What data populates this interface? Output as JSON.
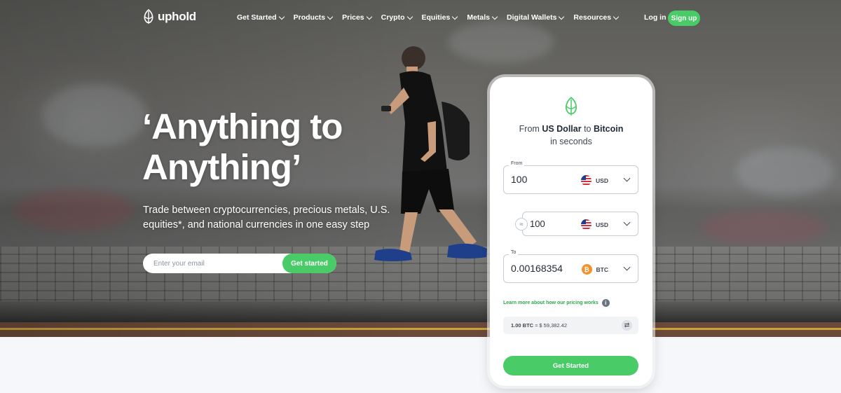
{
  "nav": {
    "logo_text": "uphold",
    "items": [
      {
        "label": "Get Started"
      },
      {
        "label": "Products"
      },
      {
        "label": "Prices"
      },
      {
        "label": "Crypto"
      },
      {
        "label": "Equities"
      },
      {
        "label": "Metals"
      },
      {
        "label": "Digital Wallets"
      },
      {
        "label": "Resources"
      }
    ],
    "login": "Log in",
    "signup": "Sign up"
  },
  "hero": {
    "headline_line1": "‘Anything to",
    "headline_line2": "Anything’",
    "subtext": "Trade between cryptocurrencies, precious metals, U.S. equities*, and national currencies in one easy step",
    "email_placeholder": "Enter your email",
    "cta": "Get started"
  },
  "widget": {
    "title_prefix": "From",
    "from_name": "US Dollar",
    "title_mid": "to",
    "to_name": "Bitcoin",
    "title_suffix": "in seconds",
    "from": {
      "label": "From",
      "value": "100",
      "currency": "USD"
    },
    "swap": {
      "value": "100",
      "currency": "USD"
    },
    "to": {
      "label": "To",
      "value": "0.00168354",
      "currency": "BTC"
    },
    "learn_more": "Learn more about how our pricing works",
    "rate_left": "1.00 BTC",
    "rate_right": "≈ $ 59,382.42",
    "cta": "Get Started"
  },
  "colors": {
    "accent": "#49cc68",
    "link": "#2fa84f",
    "text_dark": "#1f2933",
    "btc": "#f3922b"
  }
}
